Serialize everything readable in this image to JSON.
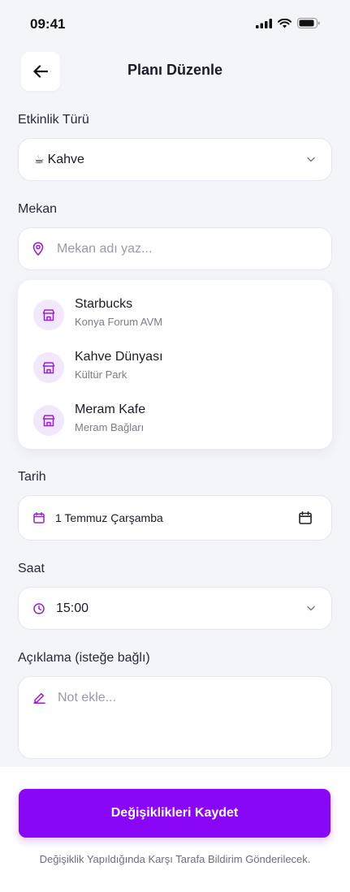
{
  "status": {
    "time": "09:41"
  },
  "header": {
    "title": "Planı Düzenle"
  },
  "event_type": {
    "label": "Etkinlik Türü",
    "emoji": "☕",
    "value": "Kahve"
  },
  "venue": {
    "label": "Mekan",
    "placeholder": "Mekan adı yaz...",
    "suggestions": [
      {
        "name": "Starbucks",
        "location": "Konya Forum AVM"
      },
      {
        "name": "Kahve Dünyası",
        "location": "Kültür Park"
      },
      {
        "name": "Meram Kafe",
        "location": "Meram Bağları"
      }
    ]
  },
  "date": {
    "label": "Tarih",
    "value": "1 Temmuz Çarşamba"
  },
  "time": {
    "label": "Saat",
    "value": "15:00"
  },
  "description": {
    "label": "Açıklama (isteğe bağlı)",
    "placeholder": "Not ekle..."
  },
  "actions": {
    "save_label": "Değişiklikleri Kaydet",
    "note": "Değişiklik Yapıldığında Karşı Tarafa Bildirim Gönderilecek."
  },
  "colors": {
    "accent": "#8A06F6",
    "icon_purple": "#9B1FD8",
    "icon_bg": "#F2E8FC"
  }
}
